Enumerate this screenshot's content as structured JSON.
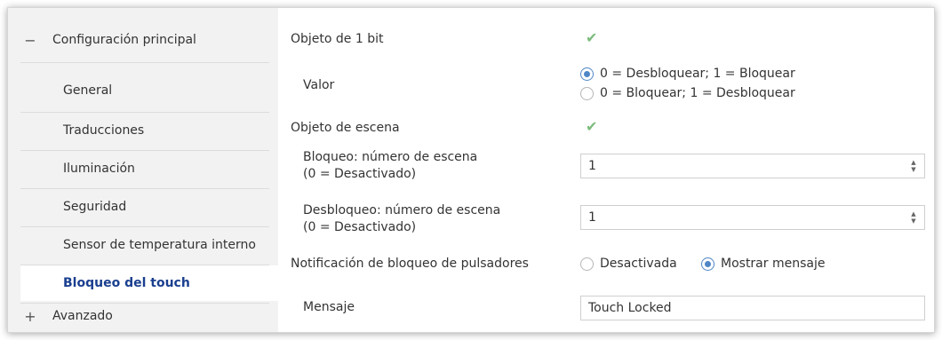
{
  "sidebar": {
    "group_main": {
      "symbol": "−",
      "label": "Configuración principal"
    },
    "items": [
      {
        "label": "General"
      },
      {
        "label": "Traducciones"
      },
      {
        "label": "Iluminación"
      },
      {
        "label": "Seguridad"
      },
      {
        "label": "Sensor de temperatura interno"
      },
      {
        "label": "Bloqueo del touch",
        "active": true
      }
    ],
    "group_advanced": {
      "symbol": "+",
      "label": "Avanzado"
    }
  },
  "main": {
    "obj1bit": {
      "label": "Objeto de 1 bit",
      "checked": true,
      "check_glyph": "✔"
    },
    "valor": {
      "label": "Valor",
      "options": [
        "0 = Desbloquear; 1 = Bloquear",
        "0 = Bloquear; 1 = Desbloquear"
      ],
      "selected": 0
    },
    "objescena": {
      "label": "Objeto de escena",
      "checked": true,
      "check_glyph": "✔"
    },
    "bloqueo": {
      "label1": "Bloqueo: número de escena",
      "label2": "(0 = Desactivado)",
      "value": "1"
    },
    "desbloqueo": {
      "label1": "Desbloqueo: número de escena",
      "label2": "(0 = Desactivado)",
      "value": "1"
    },
    "notificacion": {
      "label": "Notificación de bloqueo de pulsadores",
      "options": [
        "Desactivada",
        "Mostrar mensaje"
      ],
      "selected": 1
    },
    "mensaje": {
      "label": "Mensaje",
      "value": "Touch Locked"
    },
    "spin_up": "▲",
    "spin_down": "▼"
  },
  "colors": {
    "accent": "#1a3f8f",
    "radio": "#4f86c6",
    "check": "#7cbb7c"
  }
}
